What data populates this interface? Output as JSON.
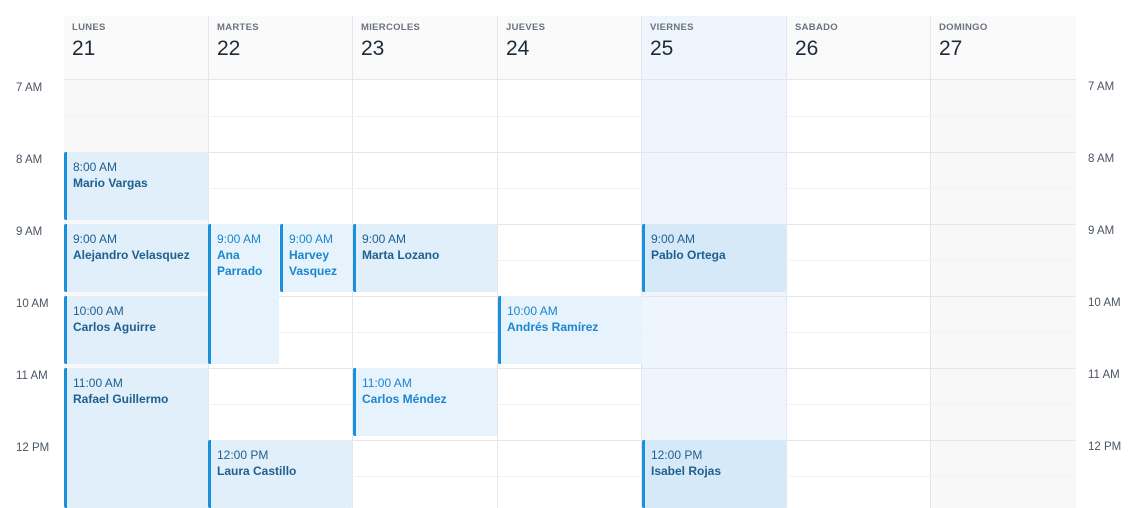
{
  "days": [
    {
      "name": "LUNES",
      "num": "21"
    },
    {
      "name": "MARTES",
      "num": "22"
    },
    {
      "name": "MIERCOLES",
      "num": "23"
    },
    {
      "name": "JUEVES",
      "num": "24"
    },
    {
      "name": "VIERNES",
      "num": "25"
    },
    {
      "name": "SABADO",
      "num": "26"
    },
    {
      "name": "DOMINGO",
      "num": "27"
    }
  ],
  "hours": [
    "7 AM",
    "8 AM",
    "9 AM",
    "10 AM",
    "11 AM",
    "12 PM"
  ],
  "events": [
    {
      "time": "8:00 AM",
      "name": "Mario Vargas"
    },
    {
      "time": "9:00 AM",
      "name": "Alejandro Velasquez"
    },
    {
      "time": "10:00 AM",
      "name": "Carlos Aguirre"
    },
    {
      "time": "11:00 AM",
      "name": "Rafael Guillermo"
    },
    {
      "time": "9:00 AM",
      "name": "Ana Parrado"
    },
    {
      "time": "9:00 AM",
      "name": "Harvey Vasquez"
    },
    {
      "time": "12:00 PM",
      "name": "Laura Castillo"
    },
    {
      "time": "9:00 AM",
      "name": "Marta Lozano"
    },
    {
      "time": "11:00 AM",
      "name": "Carlos Méndez"
    },
    {
      "time": "10:00 AM",
      "name": "Andrés Ramírez"
    },
    {
      "time": "9:00 AM",
      "name": "Pablo Ortega"
    },
    {
      "time": "12:00 PM",
      "name": "Isabel Rojas"
    }
  ],
  "colors": {
    "accent": "#1a8fdc",
    "today_bg": "#eef5fd",
    "event_bg": "#e0eff9"
  }
}
